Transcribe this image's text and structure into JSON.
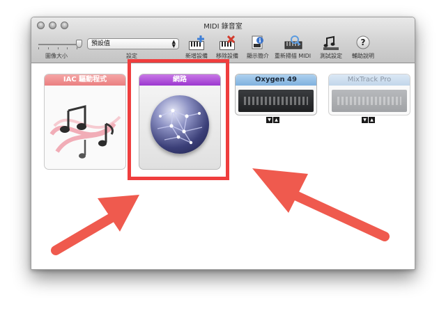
{
  "window": {
    "title": "MIDI 錄音室"
  },
  "toolbar": {
    "icon_size_label": "圖像大小",
    "config_label": "設定",
    "config_value": "預設值",
    "buttons": [
      {
        "label": "新增設備",
        "icon": "add-device-icon"
      },
      {
        "label": "移除設備",
        "icon": "remove-device-icon"
      },
      {
        "label": "顯示簡介",
        "icon": "show-info-icon"
      },
      {
        "label": "重新掃描 MIDI",
        "icon": "rescan-midi-icon"
      },
      {
        "label": "測試設定",
        "icon": "test-setup-icon"
      },
      {
        "label": "輔助說明",
        "icon": "help-icon"
      }
    ]
  },
  "devices": [
    {
      "name": "IAC 驅動程式",
      "icon": "music-notes-icon",
      "color": "#ea7f80"
    },
    {
      "name": "網路",
      "icon": "network-globe-icon",
      "color": "#9b37cf",
      "highlighted": true
    },
    {
      "name": "Oxygen 49",
      "icon": "keyboard-panel-icon",
      "color": "#7fb1df"
    },
    {
      "name": "MixTrack Pro",
      "icon": "controller-panel-icon",
      "color": "#c2d6ea"
    }
  ],
  "annotation": {
    "color": "#ef5a4e",
    "highlight_color": "#ef3e3e"
  }
}
